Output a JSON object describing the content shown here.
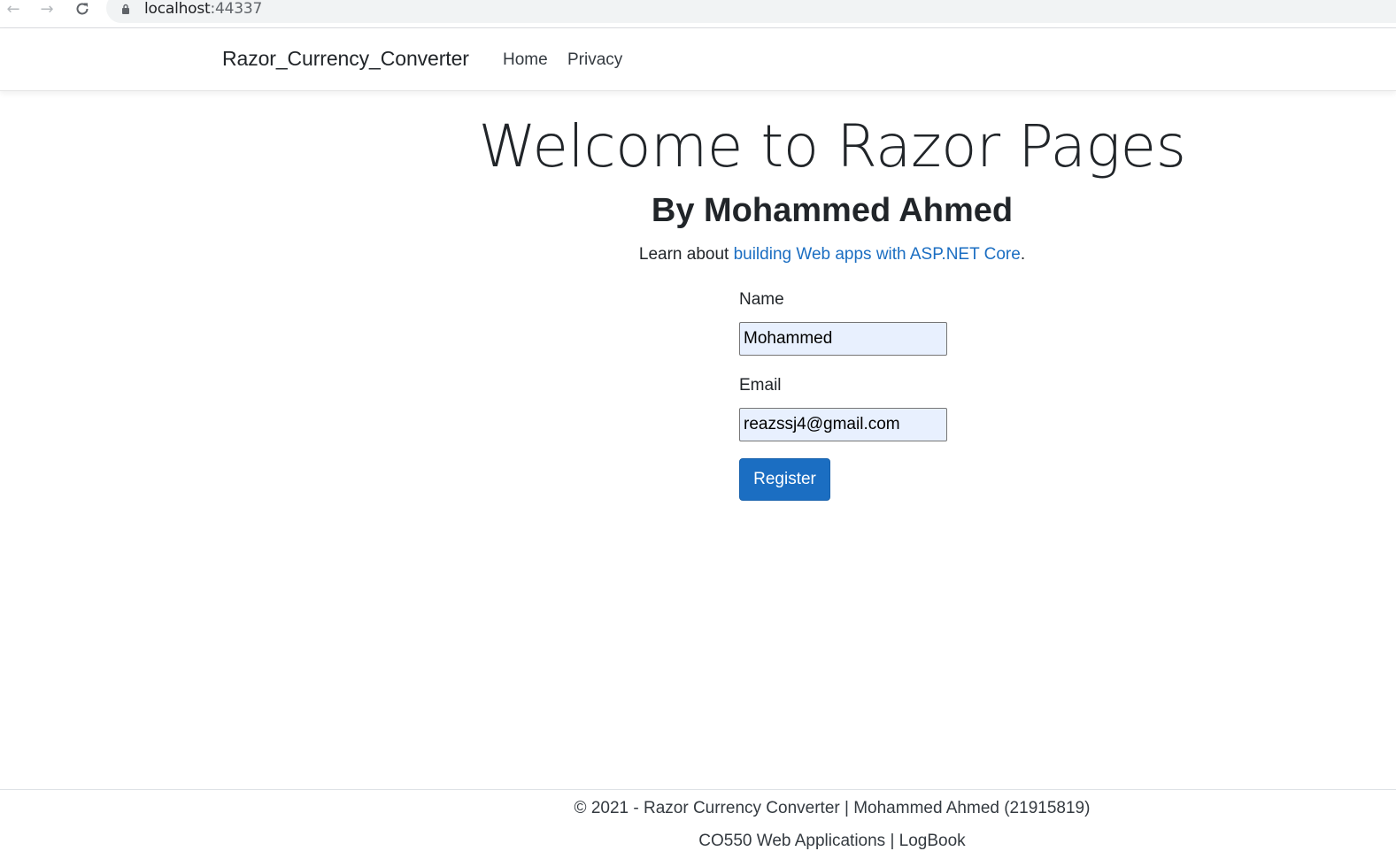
{
  "browser": {
    "url_host": "localhost",
    "url_port": ":44337",
    "icons": {
      "back": "arrow-left-icon",
      "forward": "arrow-right-icon",
      "reload": "reload-icon",
      "lock": "lock-icon"
    }
  },
  "navbar": {
    "brand": "Razor_Currency_Converter",
    "links": [
      {
        "label": "Home"
      },
      {
        "label": "Privacy"
      }
    ]
  },
  "main": {
    "title": "Welcome to Razor Pages",
    "subtitle": "By Mohammed Ahmed",
    "learn_prefix": "Learn about ",
    "learn_link": "building Web apps with ASP.NET Core",
    "learn_suffix": ".",
    "form": {
      "name_label": "Name",
      "name_value": "Mohammed",
      "email_label": "Email",
      "email_value": "reazssj4@gmail.com",
      "submit_label": "Register"
    }
  },
  "footer": {
    "line1": "© 2021 - Razor Currency Converter | Mohammed Ahmed (21915819)",
    "line2": "CO550 Web Applications | LogBook"
  },
  "colors": {
    "link": "#1b6ec2",
    "button": "#1b6ec2",
    "autofill_bg": "#e8f0fe"
  }
}
